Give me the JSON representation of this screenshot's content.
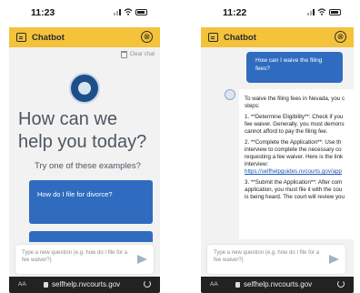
{
  "screen1": {
    "time": "11:23",
    "header_title": "Chatbot",
    "close_icon": "⊗",
    "clear_chat": "Clear chat",
    "hero_line1": "How can we",
    "hero_line2": "help you today?",
    "examples_label": "Try one of these examples?",
    "example1": "How do I file for divorce?",
    "input_placeholder": "Type a new question (e.g. how do I file for a fee waiver?)",
    "url_aa": "AA",
    "url": "selfhelp.nvcourts.gov"
  },
  "screen2": {
    "time": "11:22",
    "header_title": "Chatbot",
    "close_icon": "⊗",
    "user_message": "How can I waive the filing fees?",
    "bot_lines": [
      "To waive the filing fees in Nevada, you c",
      "steps:",
      "",
      "1. **Determine Eligibility**: Check if you",
      "fee waiver. Generally, you must demons",
      "cannot afford to pay the filing fee.",
      "",
      "2. **Complete the Application**: Use th",
      "interview to complete the necessary co",
      "requesting a fee waiver. Here is the link",
      "interview:",
      "https://selfhelpguides.nvcourts.gov/app",
      "",
      "3. **Submit the Application**: After com",
      "application, you must file it with the cou",
      "is being heard. The court will review you"
    ],
    "input_placeholder": "Type a new question (e.g. how do I file for a fee waiver?)",
    "url_aa": "AA",
    "url": "selfhelp.nvcourts.gov"
  },
  "colors": {
    "header": "#f4c23b",
    "primary_blue": "#2f6cc0",
    "hero_text": "#4d5660"
  },
  "icons": [
    "chat-icon",
    "close-icon",
    "trash-icon",
    "court-seal-icon",
    "send-icon",
    "lock-icon",
    "reload-icon",
    "bot-avatar-icon"
  ]
}
